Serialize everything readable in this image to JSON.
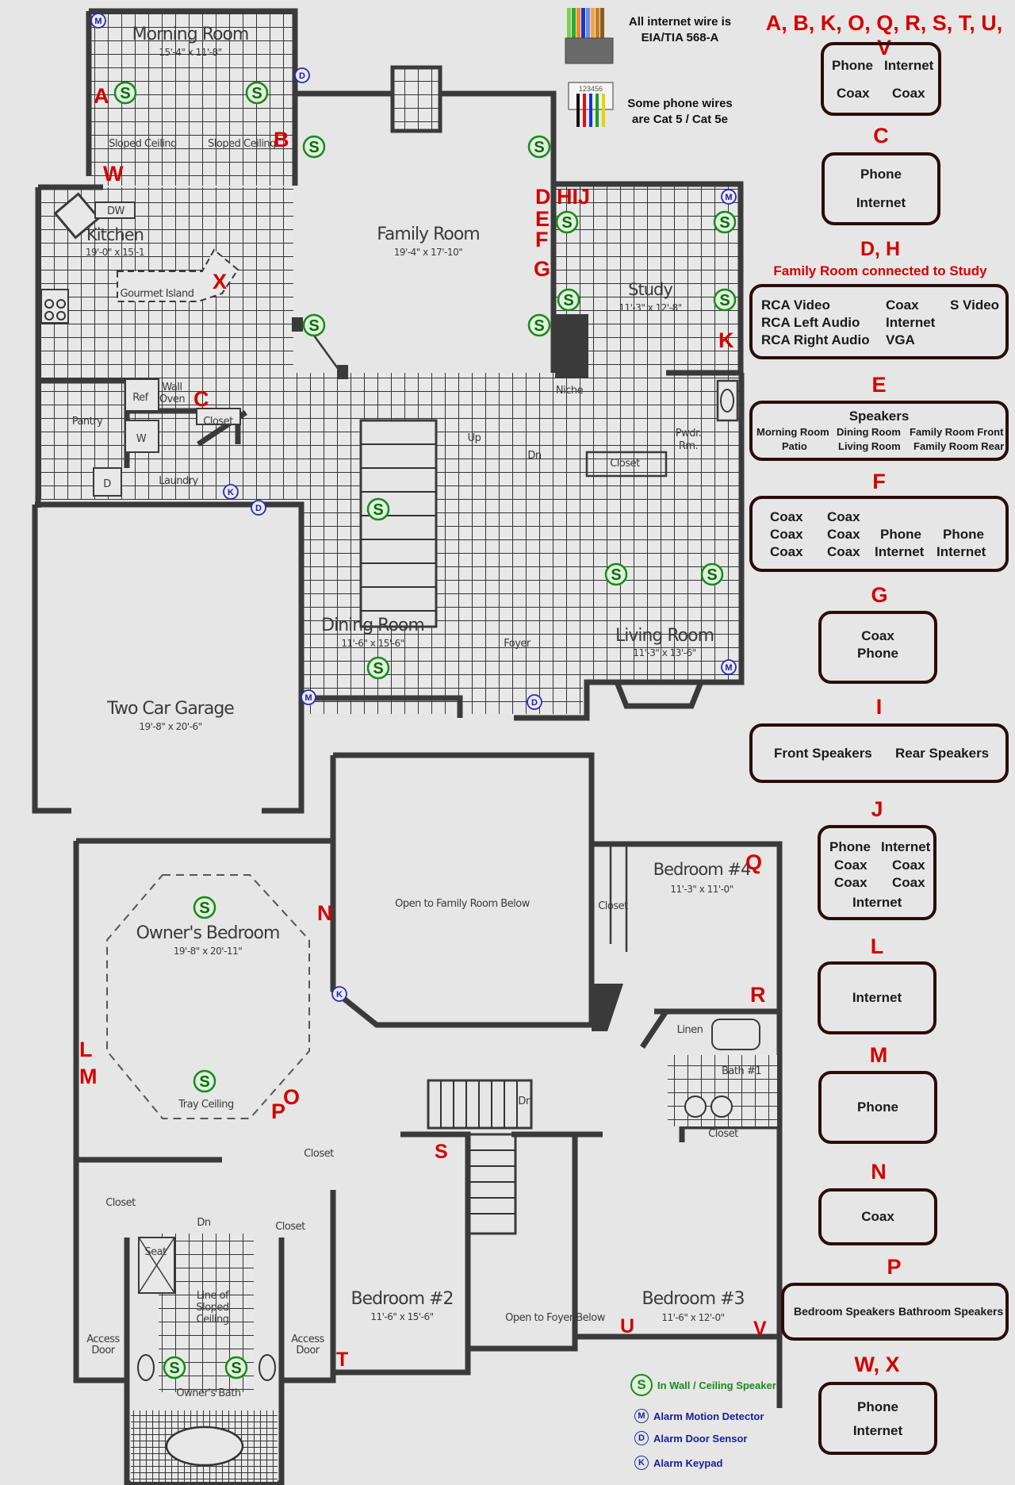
{
  "notes": {
    "internet_wire": [
      "All internet wire is",
      "EIA/TIA 568-A"
    ],
    "phone_wire": [
      "Some phone wires",
      "are Cat 5 / Cat 5e"
    ],
    "rj11_pins": "123456"
  },
  "rooms": {
    "morning_room": {
      "name": "Morning Room",
      "dim": "15'-4\" x 11'-8\""
    },
    "kitchen": {
      "name": "Kitchen",
      "dim": "19'-0\" x 15'-1"
    },
    "family_room": {
      "name": "Family Room",
      "dim": "19'-4\" x 17'-10\""
    },
    "study": {
      "name": "Study",
      "dim": "11'-3\" x 12'-8\""
    },
    "dining_room": {
      "name": "Dining Room",
      "dim": "11'-6\" x 15'-6\""
    },
    "living_room": {
      "name": "Living Room",
      "dim": "11'-3\" x 13'-6\""
    },
    "garage": {
      "name": "Two Car Garage",
      "dim": "19'-8\" x 20'-6\""
    },
    "owners_bedroom": {
      "name": "Owner's Bedroom",
      "dim": "19'-8\" x 20'-11\""
    },
    "bedroom4": {
      "name": "Bedroom #4",
      "dim": "11'-3\" x 11'-0\""
    },
    "bedroom2": {
      "name": "Bedroom #2",
      "dim": "11'-6\" x 15'-6\""
    },
    "bedroom3": {
      "name": "Bedroom #3",
      "dim": "11'-6\" x 12'-0\""
    }
  },
  "plan_labels": {
    "sloped_ceiling": "Sloped Ceiling",
    "dw": "DW",
    "gourmet_island": "Gourmet Island",
    "ref": "Ref",
    "wall_oven": [
      "Wall",
      "Oven"
    ],
    "pantry": "Pantry",
    "closet": "Closet",
    "w": "W",
    "d": "D",
    "laundry": "Laundry",
    "niche": "Niche",
    "pwdr": [
      "Pwdr.",
      "Rm."
    ],
    "up": "Up",
    "dn": "Dn",
    "foyer": "Foyer",
    "open_family": "Open to Family Room Below",
    "open_foyer": "Open to Foyer Below",
    "tray_ceiling": "Tray Ceiling",
    "linen": "Linen",
    "bath1": "Bath #1",
    "seat": "Seat",
    "line_sloped": [
      "Line of",
      "Sloped",
      "Ceiling"
    ],
    "access_door": [
      "Access",
      "Door"
    ],
    "owners_bath": "Owner's Bath"
  },
  "locations": [
    "A",
    "B",
    "C",
    "D",
    "E",
    "F",
    "G",
    "H",
    "I",
    "J",
    "K",
    "L",
    "M",
    "N",
    "O",
    "P",
    "Q",
    "R",
    "S",
    "T",
    "U",
    "V",
    "W",
    "X"
  ],
  "loc_marks": {
    "dhij": "D HIJ",
    "e": "E",
    "f": "F",
    "g": "G"
  },
  "speaker_symbol": "S",
  "alarm_symbols": {
    "motion": "M",
    "door": "D",
    "keypad": "K"
  },
  "jack_groups": [
    {
      "key": "abk",
      "header": "A, B, K, O, Q, R, S, T, U, V",
      "rows": [
        [
          "Phone",
          "Internet"
        ],
        [
          "Coax",
          "Coax"
        ]
      ]
    },
    {
      "key": "c",
      "header": "C",
      "rows": [
        [
          "Phone"
        ],
        [
          "Internet"
        ]
      ]
    },
    {
      "key": "dh",
      "header": "D, H",
      "subheader": "Family Room connected to Study",
      "rows": [
        [
          "RCA Video",
          "Coax",
          "S Video"
        ],
        [
          "RCA Left Audio",
          "Internet",
          ""
        ],
        [
          "RCA Right Audio",
          "VGA",
          ""
        ]
      ]
    },
    {
      "key": "e",
      "header": "E",
      "title": "Speakers",
      "rows": [
        [
          "Morning Room",
          "Dining Room",
          "Family Room Front"
        ],
        [
          "Patio",
          "Living Room",
          "Family Room Rear"
        ]
      ]
    },
    {
      "key": "f",
      "header": "F",
      "rows": [
        [
          "Coax",
          "Coax",
          "",
          ""
        ],
        [
          "Coax",
          "Coax",
          "Phone",
          "Phone"
        ],
        [
          "Coax",
          "Coax",
          "Internet",
          "Internet"
        ]
      ]
    },
    {
      "key": "g",
      "header": "G",
      "rows": [
        [
          "Coax"
        ],
        [
          "Phone"
        ]
      ]
    },
    {
      "key": "i",
      "header": "I",
      "rows": [
        [
          "Front Speakers",
          "Rear Speakers"
        ]
      ]
    },
    {
      "key": "j",
      "header": "J",
      "rows": [
        [
          "Phone",
          "Internet"
        ],
        [
          "Coax",
          "Coax"
        ],
        [
          "Coax",
          "Coax"
        ],
        [
          "Internet"
        ]
      ]
    },
    {
      "key": "l",
      "header": "L",
      "rows": [
        [
          "Internet"
        ]
      ]
    },
    {
      "key": "m",
      "header": "M",
      "rows": [
        [
          "Phone"
        ]
      ]
    },
    {
      "key": "n",
      "header": "N",
      "rows": [
        [
          "Coax"
        ]
      ]
    },
    {
      "key": "p",
      "header": "P",
      "rows": [
        [
          "Bedroom Speakers",
          "Bathroom Speakers"
        ]
      ]
    },
    {
      "key": "wx",
      "header": "W, X",
      "rows": [
        [
          "Phone"
        ],
        [
          "Internet"
        ]
      ]
    }
  ],
  "legend": [
    {
      "symbol": "S",
      "label": "In Wall / Ceiling Speaker",
      "color": "#1a8a1a"
    },
    {
      "symbol": "M",
      "label": "Alarm Motion Detector",
      "color": "#1c1c9a"
    },
    {
      "symbol": "D",
      "label": "Alarm Door Sensor",
      "color": "#1c1c9a"
    },
    {
      "symbol": "K",
      "label": "Alarm Keypad",
      "color": "#1c1c9a"
    }
  ],
  "colors": {
    "location_red": "#d40000",
    "speaker_green": "#1a8a1a",
    "alarm_blue": "#1c1c9a",
    "box_border": "#2b0b0b",
    "wall": "#3a3a3a",
    "background": "#e6e6e6"
  }
}
